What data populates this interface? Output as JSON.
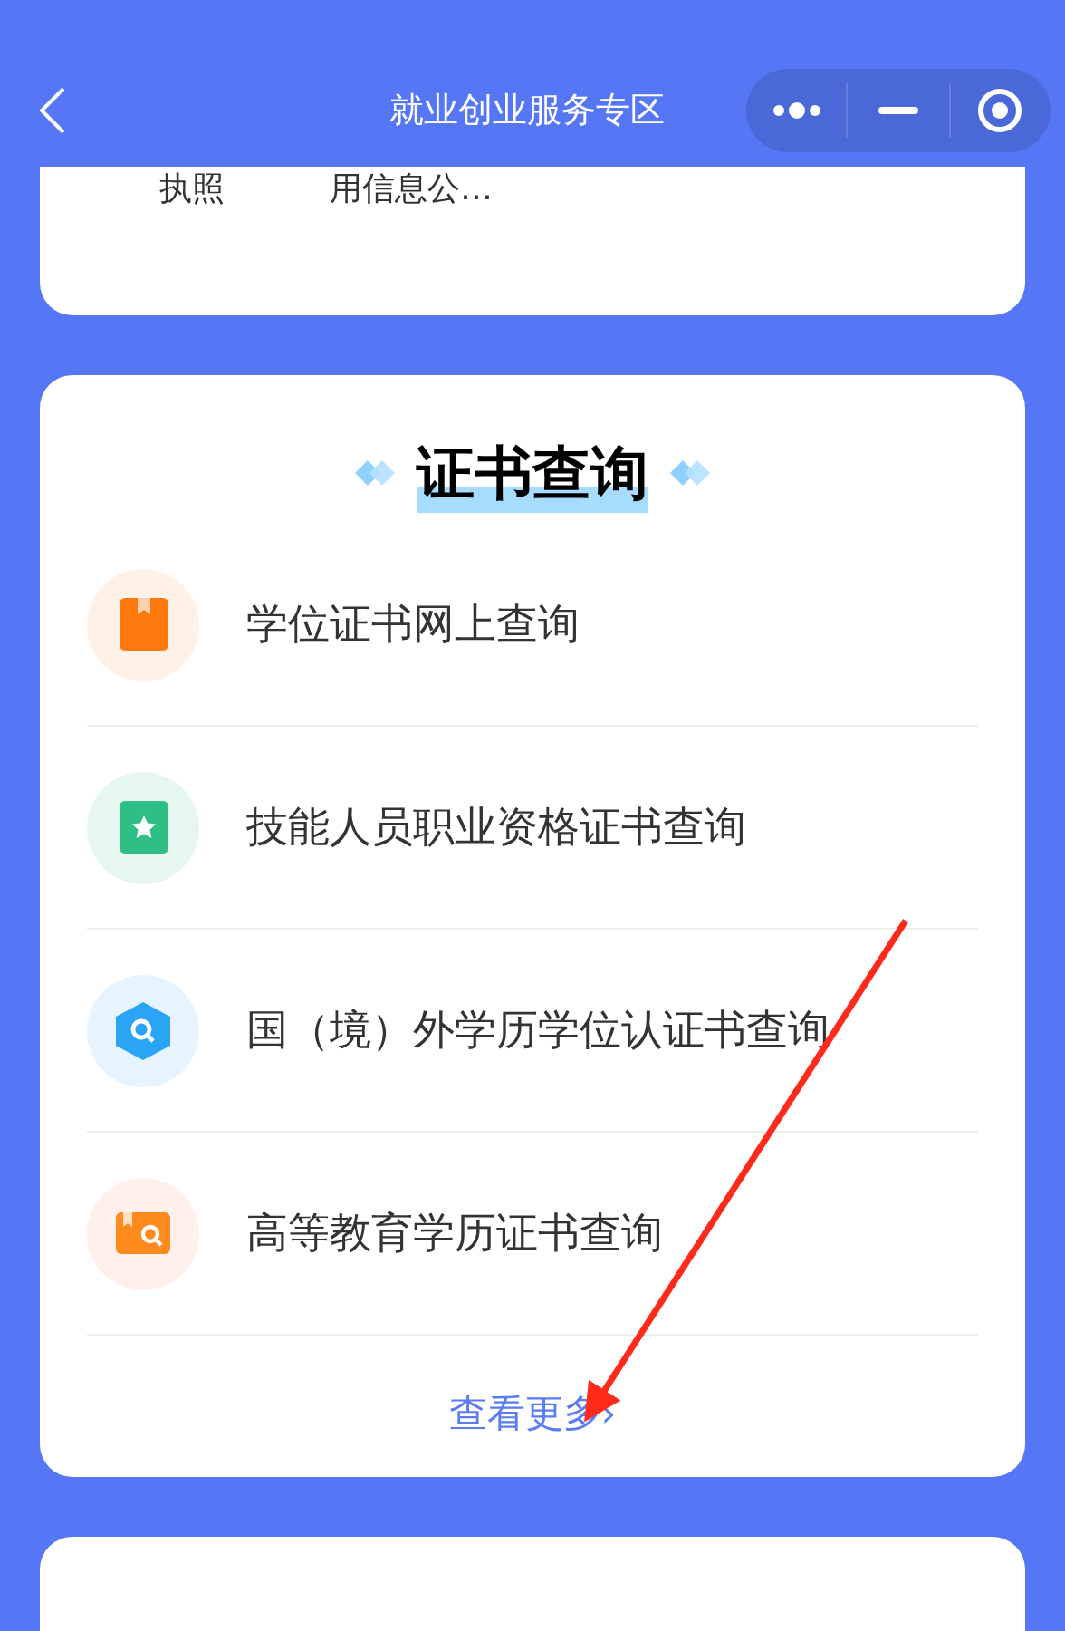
{
  "header": {
    "title": "就业创业服务专区"
  },
  "top_card": {
    "items": [
      {
        "label": "执照"
      },
      {
        "label": "用信息公…"
      }
    ]
  },
  "section": {
    "title": "证书查询",
    "items": [
      {
        "label": "学位证书网上查询",
        "kind": "book"
      },
      {
        "label": "技能人员职业资格证书查询",
        "kind": "star"
      },
      {
        "label": "国（境）外学历学位认证书查询",
        "kind": "search"
      },
      {
        "label": "高等教育学历证书查询",
        "kind": "folder"
      }
    ],
    "more": "查看更多›"
  },
  "annotations": [
    {
      "kind": "arrow"
    }
  ]
}
